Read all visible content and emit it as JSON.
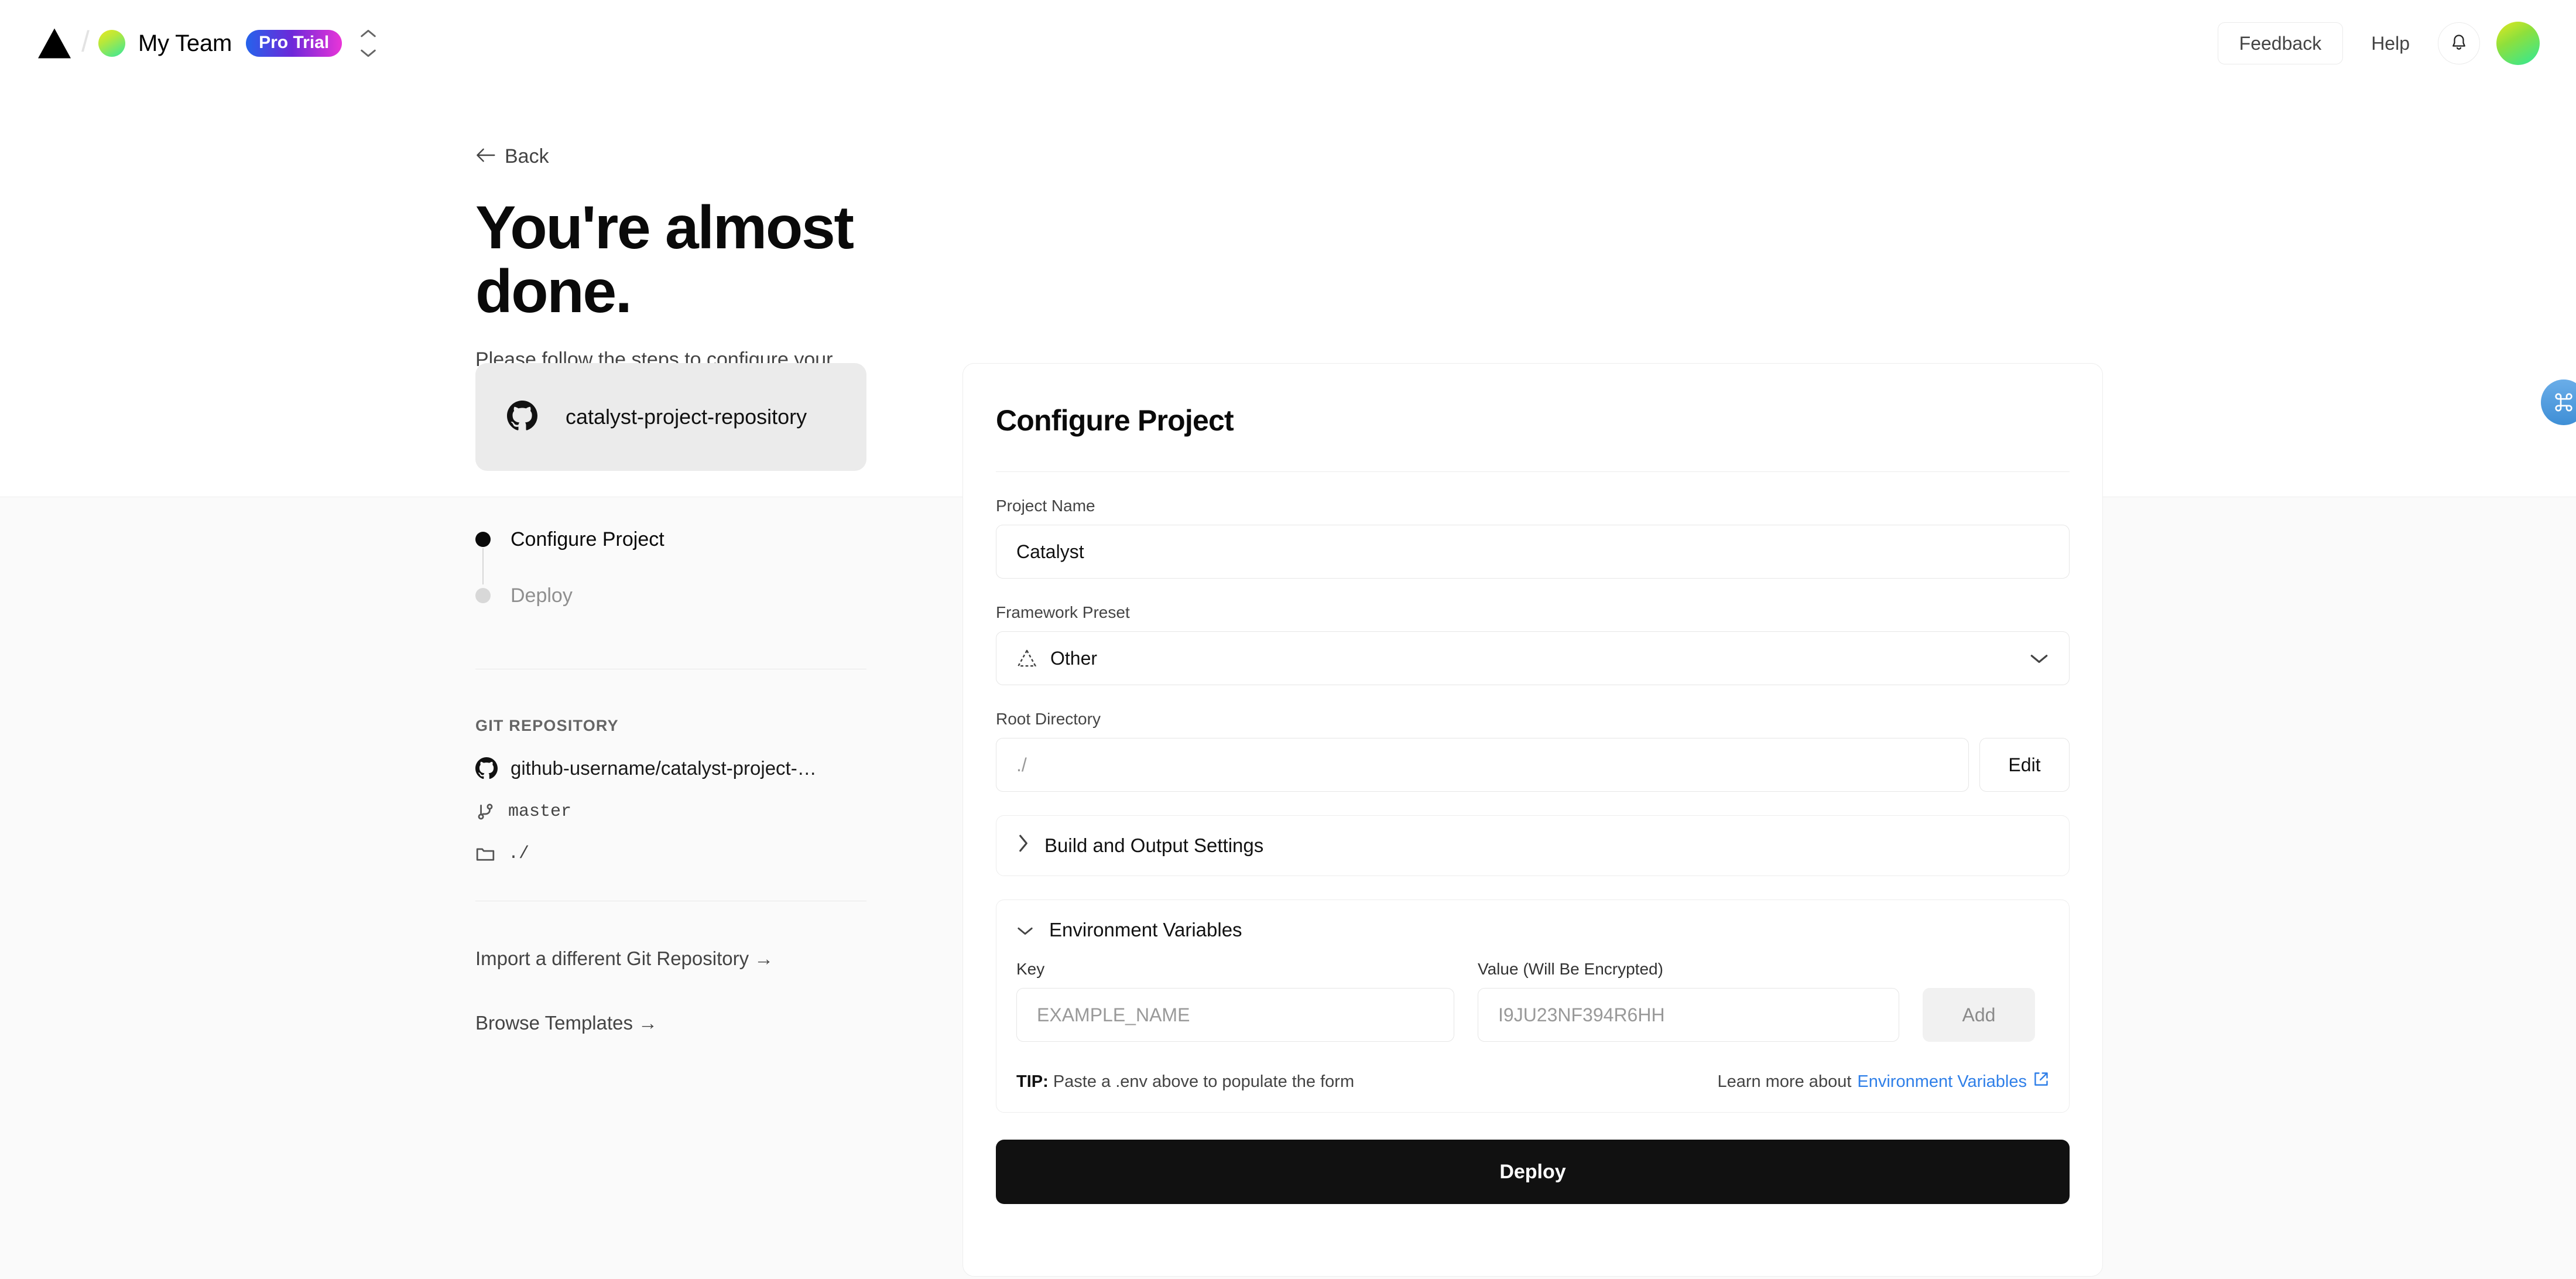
{
  "topbar": {
    "logo_icon": "vercel-triangle-logo",
    "separator": "/",
    "team_name": "My Team",
    "plan_badge": "Pro Trial",
    "team_switcher_icon": "chevron-up-down-icon",
    "feedback_label": "Feedback",
    "help_label": "Help",
    "notifications_icon": "bell-icon",
    "avatar_icon": "user-avatar"
  },
  "left": {
    "back_label": "Back",
    "back_icon": "arrow-left-icon",
    "headline": "You're almost done.",
    "subhead": "Please follow the steps to configure your Project and deploy it.",
    "repo_card": {
      "icon": "github-icon",
      "name": "catalyst-project-repository"
    },
    "steps": [
      {
        "label": "Configure Project",
        "state": "active"
      },
      {
        "label": "Deploy",
        "state": "inactive"
      }
    ],
    "git_section": {
      "title": "GIT REPOSITORY",
      "repo": "github-username/catalyst-project-…",
      "branch": "master",
      "directory": "./"
    },
    "links": [
      "Import a different Git Repository →",
      "Browse Templates →"
    ]
  },
  "card": {
    "title": "Configure Project",
    "project_name": {
      "label": "Project Name",
      "value": "Catalyst"
    },
    "framework_preset": {
      "label": "Framework Preset",
      "value": "Other",
      "icon": "dashed-triangle-icon",
      "chevron": "chevron-down-icon"
    },
    "root_directory": {
      "label": "Root Directory",
      "value": "./",
      "edit_label": "Edit"
    },
    "build_settings": {
      "label": "Build and Output Settings",
      "expanded": false,
      "chevron": "chevron-right-icon"
    },
    "environment_variables": {
      "label": "Environment Variables",
      "expanded": true,
      "chevron": "chevron-down-icon",
      "key_label": "Key",
      "key_placeholder": "EXAMPLE_NAME",
      "value_label": "Value (Will Be Encrypted)",
      "value_placeholder": "I9JU23NF394R6HH",
      "add_label": "Add",
      "tip_prefix": "TIP:",
      "tip_text": " Paste a .env above to populate the form",
      "learn_more_prefix": "Learn more about ",
      "learn_more_link": "Environment Variables",
      "learn_more_icon": "external-link-icon"
    },
    "deploy_label": "Deploy"
  },
  "widgets": {
    "command_palette_icon": "command-icon"
  },
  "colors": {
    "accent_link": "#2f7fe8",
    "deploy_button": "#111111",
    "badge_gradient_start": "#2563eb",
    "badge_gradient_end": "#e935d8",
    "page_bg_lower": "#fafafa"
  }
}
